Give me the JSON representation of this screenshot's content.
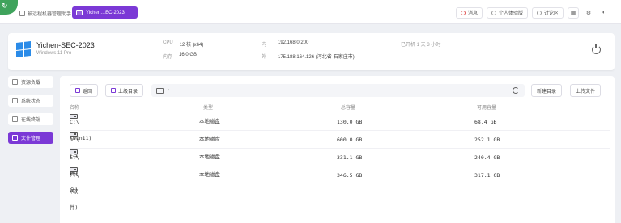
{
  "topbar": {
    "logo_glyph": "↻",
    "home_tab": "被远程机器管理助手",
    "active_tab": "Yichen…EC-2023",
    "right": {
      "alerts_label": "消息",
      "profile_label": "个人体验版",
      "community_label": "讨论区"
    }
  },
  "machine": {
    "name": "Yichen-SEC-2023",
    "os": "Windows 11 Pro",
    "cpu_key": "CPU",
    "cpu_val": "12 核 (x64)",
    "mem_key": "内存",
    "mem_val": "16.0 GB",
    "lan_key": "内",
    "lan_val": "192.168.0.200",
    "wan_key": "外",
    "wan_val": "175.188.164.126 (河北省-石家庄市)",
    "uptime": "已开机 1 天 3 小时"
  },
  "sidebar": {
    "items": [
      {
        "label": "资源负载"
      },
      {
        "label": "系统状态"
      },
      {
        "label": "在线终端"
      },
      {
        "label": "文件管理"
      }
    ]
  },
  "toolbar": {
    "back_label": "返回",
    "up_label": "上级目录",
    "path_sep": "›",
    "new_dir_label": "新建目录",
    "upload_label": "上传文件"
  },
  "table": {
    "headers": [
      "名称",
      "类型",
      "总容量",
      "可用容量"
    ],
    "rows": [
      {
        "name": "C:\\(Win11)",
        "type": "本地磁盘",
        "total": "130.0 GB",
        "free": "68.4 GB"
      },
      {
        "name": "D:\\(存储)",
        "type": "本地磁盘",
        "total": "600.0 GB",
        "free": "252.1 GB"
      },
      {
        "name": "E:\\(安全)",
        "type": "本地磁盘",
        "total": "331.1 GB",
        "free": "240.4 GB"
      },
      {
        "name": "F:\\(软件)",
        "type": "本地磁盘",
        "total": "346.5 GB",
        "free": "317.1 GB"
      }
    ]
  },
  "colors": {
    "accent": "#7b39d6",
    "brand_green": "#3fa35c",
    "windows_blue": "#2a8be8"
  }
}
